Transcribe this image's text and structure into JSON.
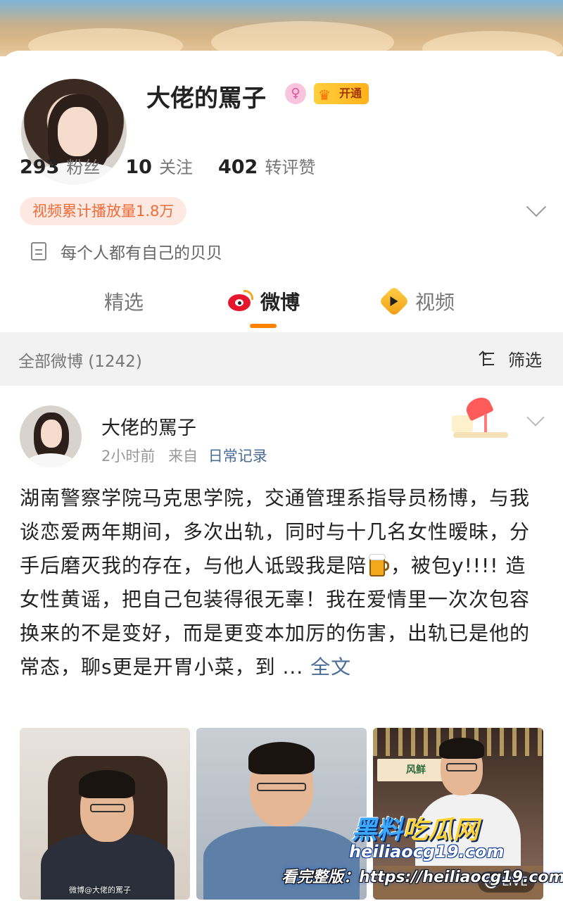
{
  "profile": {
    "name": "大佬的罵子",
    "gender_symbol": "♀",
    "vip_label": "开通",
    "stats": [
      {
        "num": "293",
        "label": "粉丝"
      },
      {
        "num": "10",
        "label": "关注"
      },
      {
        "num": "402",
        "label": "转评赞"
      }
    ],
    "play_count": "视频累计播放量1.8万",
    "bio": "每个人都有自己的贝贝"
  },
  "tabs": [
    {
      "label": "精选",
      "active": false
    },
    {
      "label": "微博",
      "active": true
    },
    {
      "label": "视频",
      "active": false
    }
  ],
  "filter_bar": {
    "count_label": "全部微博 (1242)",
    "filter_label": "筛选"
  },
  "post": {
    "author": "大佬的罵子",
    "time": "2小时前",
    "from": "来自",
    "source": "日常记录",
    "body_part1": "湖南警察学院马克思学院，交通管理系指导员杨博，与我谈恋爱两年期间，多次出轨，同时与十几名女性暧昧，分手后磨灭我的存在，与他人诋毁我是陪",
    "body_part2": "，被包y!!!! 造女性黄谣，把自己包装得很无辜！我在爱情里一次次包容换来的不是变好，而是更变本加厉的伤害，出轨已是他的常态，聊s更是开胃小菜，到 ...",
    "more_label": " 全文",
    "thumb1_watermark": "微博@大佬的罵子",
    "thumb3_sign": "风鲜",
    "live_label": "LIVE"
  },
  "watermark": {
    "title_a": "黑料",
    "title_b": "吃瓜网",
    "site": "heiliaocg19.com",
    "url_line": "看完整版：https://heiliaocg19.com"
  },
  "colors": {
    "accent_orange": "#ff8200",
    "link_blue": "#4a6c97",
    "weibo_red": "#e6162d"
  }
}
